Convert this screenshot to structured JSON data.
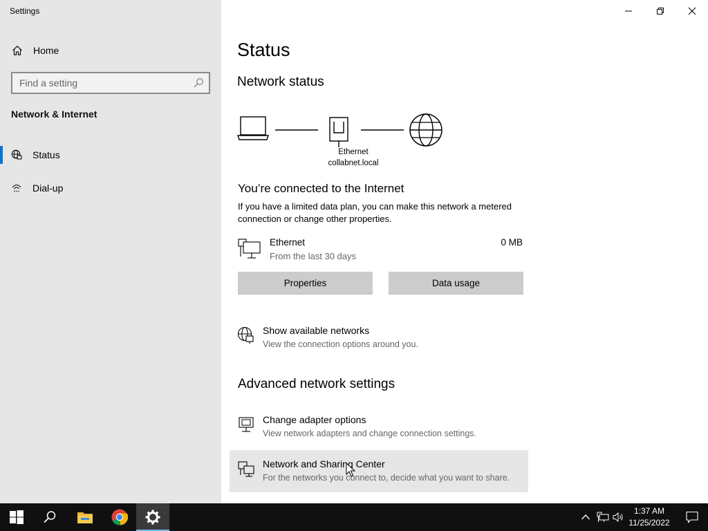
{
  "window": {
    "title": "Settings"
  },
  "sidebar": {
    "home_label": "Home",
    "search_placeholder": "Find a setting",
    "section_title": "Network & Internet",
    "items": [
      {
        "label": "Status",
        "icon": "globe-network-icon",
        "selected": true
      },
      {
        "label": "Dial-up",
        "icon": "dial-up-icon",
        "selected": false
      }
    ]
  },
  "main": {
    "page_title": "Status",
    "network_status_heading": "Network status",
    "diagram": {
      "adapter_label": "Ethernet",
      "domain_label": "collabnet.local"
    },
    "connection_title": "You’re connected to the Internet",
    "connection_desc": "If you have a limited data plan, you can make this network a metered connection or change other properties.",
    "ethernet": {
      "name": "Ethernet",
      "subtitle": "From the last 30 days",
      "usage": "0 MB"
    },
    "buttons": {
      "properties": "Properties",
      "data_usage": "Data usage"
    },
    "show_networks": {
      "title": "Show available networks",
      "subtitle": "View the connection options around you."
    },
    "advanced_heading": "Advanced network settings",
    "advanced_items": [
      {
        "title": "Change adapter options",
        "subtitle": "View network adapters and change connection settings.",
        "icon": "adapter-icon"
      },
      {
        "title": "Network and Sharing Center",
        "subtitle": "For the networks you connect to, decide what you want to share.",
        "icon": "sharing-center-icon"
      }
    ]
  },
  "taskbar": {
    "apps": [
      "start-icon",
      "search-icon",
      "file-explorer-icon",
      "chrome-icon",
      "settings-gear-icon"
    ],
    "time": "1:37 AM",
    "date": "11/25/2022"
  },
  "colors": {
    "accent": "#0078d7",
    "sidebar_bg": "#e6e6e6",
    "taskbar_bg": "#101010"
  }
}
